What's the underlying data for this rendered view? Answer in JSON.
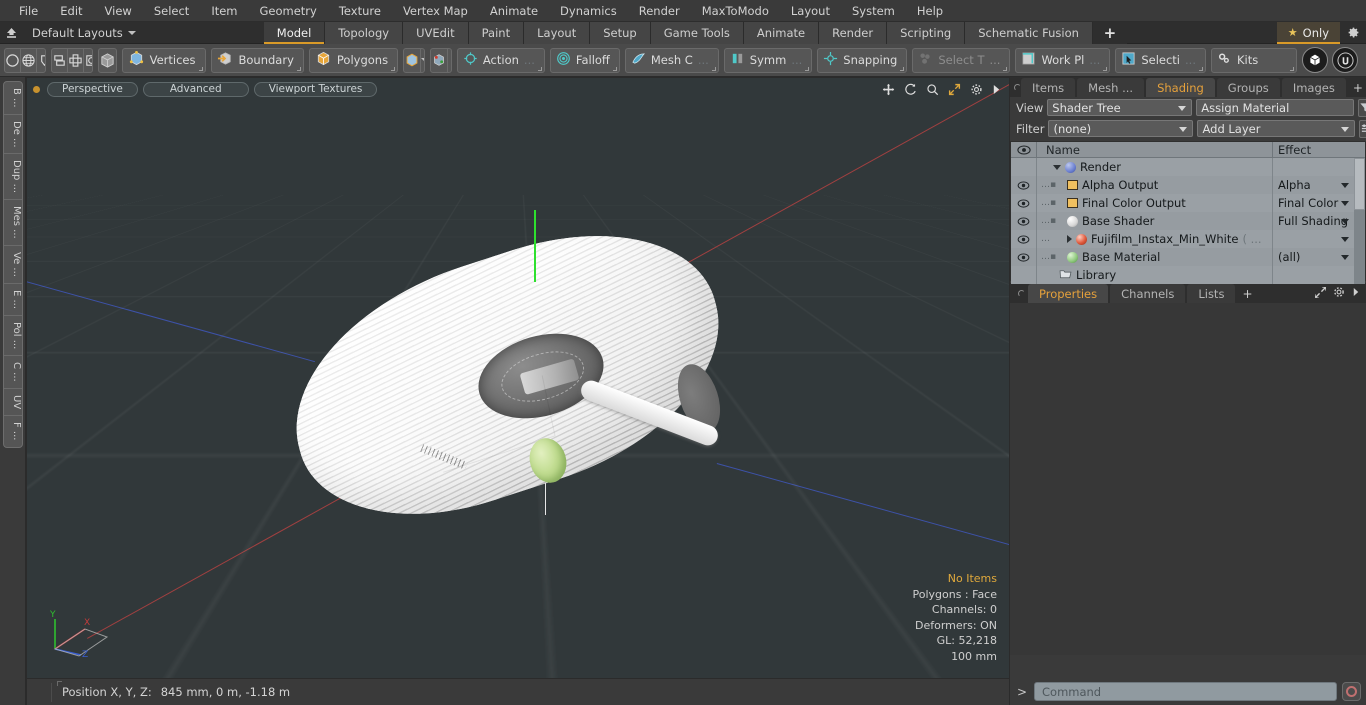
{
  "app": {
    "title": "Modo",
    "accent": "#d99a28",
    "viewport_bg": "#31383a",
    "panel_bg": "#3a3a3a",
    "tree_bg": "#9aa0a5"
  },
  "menubar": {
    "items": [
      {
        "label": "File"
      },
      {
        "label": "Edit"
      },
      {
        "label": "View"
      },
      {
        "label": "Select"
      },
      {
        "label": "Item"
      },
      {
        "label": "Geometry"
      },
      {
        "label": "Texture"
      },
      {
        "label": "Vertex Map"
      },
      {
        "label": "Animate"
      },
      {
        "label": "Dynamics"
      },
      {
        "label": "Render"
      },
      {
        "label": "MaxToModo"
      },
      {
        "label": "Layout"
      },
      {
        "label": "System"
      },
      {
        "label": "Help"
      }
    ]
  },
  "layoutbar": {
    "home_icon": "home-up-icon",
    "layouts_label": "Default Layouts",
    "tabs": [
      {
        "label": "Model",
        "active": true
      },
      {
        "label": "Topology",
        "active": false
      },
      {
        "label": "UVEdit",
        "active": false
      },
      {
        "label": "Paint",
        "active": false
      },
      {
        "label": "Layout",
        "active": false
      },
      {
        "label": "Setup",
        "active": false
      },
      {
        "label": "Game Tools",
        "active": false
      },
      {
        "label": "Animate",
        "active": false
      },
      {
        "label": "Render",
        "active": false
      },
      {
        "label": "Scripting",
        "active": false
      },
      {
        "label": "Schematic Fusion",
        "active": false
      }
    ],
    "add_tab_label": "+",
    "only_label": "Only",
    "only_icon": "star-icon",
    "gear_icon": "gear-icon"
  },
  "toolbar": {
    "shape_icons": [
      "circle-icon",
      "globe-icon",
      "pen-icon",
      "cut-icon"
    ],
    "arrange_icons": [
      "stack-icon",
      "center-icon",
      "frame-icon",
      "radial-icon"
    ],
    "solo_icon": "cube-solid-icon",
    "mode_buttons": [
      {
        "label": "Vertices",
        "icon": "vertices-cube-icon"
      },
      {
        "label": "Boundary",
        "icon": "boundary-cube-icon"
      },
      {
        "label": "Polygons",
        "icon": "polygons-cube-icon"
      }
    ],
    "selection_cube_icon": "cube-orange-icon",
    "selection_caret": "chevron-down-icon",
    "snap_icons": [
      "cube-pin-a-icon",
      "cube-pin-b-icon"
    ],
    "tool_buttons": [
      {
        "label": "Action",
        "suffix": "...",
        "icon": "action-center-icon",
        "dim": false
      },
      {
        "label": "Falloff",
        "suffix": "",
        "icon": "falloff-icon",
        "dim": false
      },
      {
        "label": "Mesh C",
        "suffix": "...",
        "icon": "mesh-constraint-icon",
        "dim": false
      },
      {
        "label": "Symm",
        "suffix": "...",
        "icon": "symmetry-icon",
        "dim": false
      },
      {
        "label": "Snapping",
        "suffix": "",
        "icon": "snapping-icon",
        "dim": false
      },
      {
        "label": "Select T",
        "suffix": "...",
        "icon": "select-through-icon",
        "dim": true
      },
      {
        "label": "Work Pl",
        "suffix": "...",
        "icon": "work-plane-icon",
        "dim": false
      },
      {
        "label": "Selecti",
        "suffix": "...",
        "icon": "selection-set-icon",
        "dim": false
      },
      {
        "label": "Kits",
        "suffix": "",
        "icon": "kits-gears-icon",
        "dim": false
      }
    ],
    "round_buttons": [
      "modo-bob-icon",
      "unreal-engine-icon"
    ]
  },
  "left_strip": {
    "tabs": [
      {
        "label": "B ..."
      },
      {
        "label": "De ..."
      },
      {
        "label": "Dup ..."
      },
      {
        "label": "Mes ..."
      },
      {
        "label": "Ve ..."
      },
      {
        "label": "E ..."
      },
      {
        "label": "Pol ..."
      },
      {
        "label": "C ..."
      },
      {
        "label": "UV"
      },
      {
        "label": "F ..."
      }
    ]
  },
  "viewport": {
    "dot_icon": "viewport-active-dot",
    "pills": [
      {
        "label": "Perspective"
      },
      {
        "label": "Advanced"
      },
      {
        "label": "Viewport Textures"
      }
    ],
    "header_icons": [
      "move-icon",
      "rotate-icon",
      "zoom-icon",
      "fit-icon",
      "gear-icon",
      "chevron-right-icon"
    ],
    "gizmo": {
      "x": "X",
      "y": "Y",
      "z": "Z"
    },
    "info": {
      "items_status": "No Items",
      "polygons": "Polygons : Face",
      "channels": "Channels: 0",
      "deformers": "Deformers: ON",
      "gl": "GL: 52,218",
      "scale": "100 mm"
    }
  },
  "statusbar": {
    "position_label": "Position X, Y, Z:",
    "position_value": "845 mm, 0 m, -1.18 m"
  },
  "right_panel": {
    "top_tabs": [
      {
        "label": "Items",
        "active": false
      },
      {
        "label": "Mesh ...",
        "active": false
      },
      {
        "label": "Shading",
        "active": true
      },
      {
        "label": "Groups",
        "active": false
      },
      {
        "label": "Images",
        "active": false
      }
    ],
    "top_tabs_plus": "+",
    "top_tab_icons": [
      "expand-icon",
      "gear-icon",
      "chevron-right-icon"
    ],
    "view_label": "View",
    "view_value": "Shader Tree",
    "assign_material_label": "Assign Material",
    "filter_label": "Filter",
    "filter_value": "(none)",
    "add_layer_label": "Add Layer",
    "filter_icon": "funnel-icon",
    "list_icon": "list-options-icon",
    "tree": {
      "columns": {
        "eye": "visibility-icon",
        "name": "Name",
        "effect": "Effect"
      },
      "rows": [
        {
          "name": "Render",
          "effect": "",
          "icon": "sphere-blue-icon",
          "indent": 0,
          "twisty": "down",
          "eye": false,
          "caret": false
        },
        {
          "name": "Alpha Output",
          "effect": "Alpha",
          "icon": "image-output-icon",
          "indent": 1,
          "twisty": "none",
          "eye": true,
          "caret": true
        },
        {
          "name": "Final Color Output",
          "effect": "Final Color",
          "icon": "image-output-icon",
          "indent": 1,
          "twisty": "none",
          "eye": true,
          "caret": true
        },
        {
          "name": "Base Shader",
          "effect": "Full Shading",
          "icon": "sphere-white-icon",
          "indent": 1,
          "twisty": "none",
          "eye": true,
          "caret": true
        },
        {
          "name": "Fujifilm_Instax_Min_White",
          "name_suffix": "( ...",
          "effect": "",
          "icon": "sphere-red-icon",
          "indent": 1,
          "twisty": "right",
          "eye": true,
          "caret": true
        },
        {
          "name": "Base Material",
          "effect": "(all)",
          "icon": "sphere-green-icon",
          "indent": 1,
          "twisty": "none",
          "eye": true,
          "caret": true
        },
        {
          "name": "Library",
          "effect": "",
          "icon": "folder-icon",
          "indent": 0,
          "twisty": "none",
          "eye": false,
          "caret": false
        }
      ]
    },
    "prop_tabs": [
      {
        "label": "Properties",
        "active": true
      },
      {
        "label": "Channels",
        "active": false
      },
      {
        "label": "Lists",
        "active": false
      }
    ],
    "prop_tabs_plus": "+",
    "prop_tab_icons": [
      "expand-icon",
      "gear-icon",
      "chevron-right-icon"
    ]
  },
  "command": {
    "prompt": ">",
    "placeholder": "Command",
    "record_icon": "record-icon"
  }
}
